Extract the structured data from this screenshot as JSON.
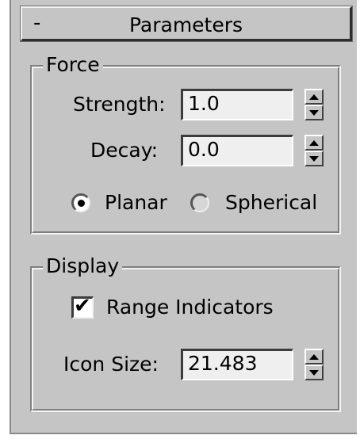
{
  "title_bar": {
    "collapse_symbol": "-",
    "title": "Parameters"
  },
  "force": {
    "legend": "Force",
    "strength": {
      "label": "Strength:",
      "value": "1.0"
    },
    "decay": {
      "label": "Decay:",
      "value": "0.0"
    },
    "mode": {
      "options": [
        {
          "label": "Planar",
          "selected": true
        },
        {
          "label": "Spherical",
          "selected": false
        }
      ]
    }
  },
  "display": {
    "legend": "Display",
    "range_indicators": {
      "label": "Range Indicators",
      "checked": true,
      "check_glyph": "✔"
    },
    "icon_size": {
      "label": "Icon Size:",
      "value": "21.483"
    }
  }
}
